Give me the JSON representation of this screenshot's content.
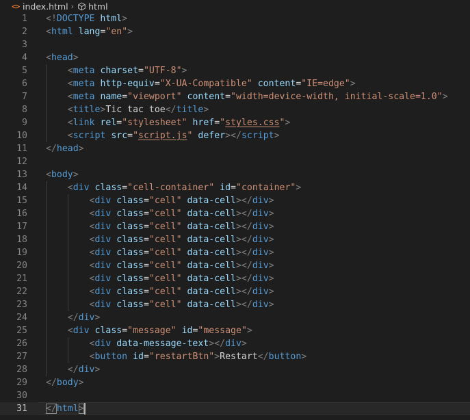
{
  "breadcrumb": {
    "file_icon": "<>",
    "file_name": "index.html",
    "separator": "›",
    "node_icon": "html-element-icon",
    "node_name": "html"
  },
  "theme": {
    "background": "#1e1e1e",
    "tag": "#569cd6",
    "bracket": "#808080",
    "attribute": "#9cdcfe",
    "string": "#ce9178",
    "text": "#d4d4d4",
    "line_number": "#858585"
  },
  "editor": {
    "current_line": 31,
    "lines": [
      {
        "n": "1",
        "indent": 0,
        "tokens": [
          [
            "br",
            "<!"
          ],
          [
            "tag",
            "DOCTYPE"
          ],
          [
            "txt",
            " "
          ],
          [
            "attr",
            "html"
          ],
          [
            "br",
            ">"
          ]
        ]
      },
      {
        "n": "2",
        "indent": 0,
        "tokens": [
          [
            "br",
            "<"
          ],
          [
            "tag",
            "html"
          ],
          [
            "txt",
            " "
          ],
          [
            "attr",
            "lang"
          ],
          [
            "txt",
            "="
          ],
          [
            "str",
            "\"en\""
          ],
          [
            "br",
            ">"
          ]
        ]
      },
      {
        "n": "3",
        "indent": 0,
        "tokens": []
      },
      {
        "n": "4",
        "indent": 0,
        "tokens": [
          [
            "br",
            "<"
          ],
          [
            "tag",
            "head"
          ],
          [
            "br",
            ">"
          ]
        ]
      },
      {
        "n": "5",
        "indent": 1,
        "tokens": [
          [
            "txt",
            "    "
          ],
          [
            "br",
            "<"
          ],
          [
            "tag",
            "meta"
          ],
          [
            "txt",
            " "
          ],
          [
            "attr",
            "charset"
          ],
          [
            "txt",
            "="
          ],
          [
            "str",
            "\"UTF-8\""
          ],
          [
            "br",
            ">"
          ]
        ]
      },
      {
        "n": "6",
        "indent": 1,
        "tokens": [
          [
            "txt",
            "    "
          ],
          [
            "br",
            "<"
          ],
          [
            "tag",
            "meta"
          ],
          [
            "txt",
            " "
          ],
          [
            "attr",
            "http-equiv"
          ],
          [
            "txt",
            "="
          ],
          [
            "str",
            "\"X-UA-Compatible\""
          ],
          [
            "txt",
            " "
          ],
          [
            "attr",
            "content"
          ],
          [
            "txt",
            "="
          ],
          [
            "str",
            "\"IE=edge\""
          ],
          [
            "br",
            ">"
          ]
        ]
      },
      {
        "n": "7",
        "indent": 1,
        "tokens": [
          [
            "txt",
            "    "
          ],
          [
            "br",
            "<"
          ],
          [
            "tag",
            "meta"
          ],
          [
            "txt",
            " "
          ],
          [
            "attr",
            "name"
          ],
          [
            "txt",
            "="
          ],
          [
            "str",
            "\"viewport\""
          ],
          [
            "txt",
            " "
          ],
          [
            "attr",
            "content"
          ],
          [
            "txt",
            "="
          ],
          [
            "str",
            "\"width=device-width, initial-scale=1.0\""
          ],
          [
            "br",
            ">"
          ]
        ]
      },
      {
        "n": "8",
        "indent": 1,
        "tokens": [
          [
            "txt",
            "    "
          ],
          [
            "br",
            "<"
          ],
          [
            "tag",
            "title"
          ],
          [
            "br",
            ">"
          ],
          [
            "txt",
            "Tic tac toe"
          ],
          [
            "br",
            "</"
          ],
          [
            "tag",
            "title"
          ],
          [
            "br",
            ">"
          ]
        ]
      },
      {
        "n": "9",
        "indent": 1,
        "tokens": [
          [
            "txt",
            "    "
          ],
          [
            "br",
            "<"
          ],
          [
            "tag",
            "link"
          ],
          [
            "txt",
            " "
          ],
          [
            "attr",
            "rel"
          ],
          [
            "txt",
            "="
          ],
          [
            "str",
            "\"stylesheet\""
          ],
          [
            "txt",
            " "
          ],
          [
            "attr",
            "href"
          ],
          [
            "txt",
            "="
          ],
          [
            "str",
            "\""
          ],
          [
            "strlink",
            "styles.css"
          ],
          [
            "str",
            "\""
          ],
          [
            "br",
            ">"
          ]
        ]
      },
      {
        "n": "10",
        "indent": 1,
        "tokens": [
          [
            "txt",
            "    "
          ],
          [
            "br",
            "<"
          ],
          [
            "tag",
            "script"
          ],
          [
            "txt",
            " "
          ],
          [
            "attr",
            "src"
          ],
          [
            "txt",
            "="
          ],
          [
            "str",
            "\""
          ],
          [
            "strlink",
            "script.js"
          ],
          [
            "str",
            "\""
          ],
          [
            "txt",
            " "
          ],
          [
            "attr",
            "defer"
          ],
          [
            "br",
            "></"
          ],
          [
            "tag",
            "script"
          ],
          [
            "br",
            ">"
          ]
        ]
      },
      {
        "n": "11",
        "indent": 0,
        "tokens": [
          [
            "br",
            "</"
          ],
          [
            "tag",
            "head"
          ],
          [
            "br",
            ">"
          ]
        ]
      },
      {
        "n": "12",
        "indent": 0,
        "tokens": []
      },
      {
        "n": "13",
        "indent": 0,
        "tokens": [
          [
            "br",
            "<"
          ],
          [
            "tag",
            "body"
          ],
          [
            "br",
            ">"
          ]
        ]
      },
      {
        "n": "14",
        "indent": 1,
        "tokens": [
          [
            "txt",
            "    "
          ],
          [
            "br",
            "<"
          ],
          [
            "tag",
            "div"
          ],
          [
            "txt",
            " "
          ],
          [
            "attr",
            "class"
          ],
          [
            "txt",
            "="
          ],
          [
            "str",
            "\"cell-container\""
          ],
          [
            "txt",
            " "
          ],
          [
            "attr",
            "id"
          ],
          [
            "txt",
            "="
          ],
          [
            "str",
            "\"container\""
          ],
          [
            "br",
            ">"
          ]
        ]
      },
      {
        "n": "15",
        "indent": 2,
        "tokens": [
          [
            "txt",
            "        "
          ],
          [
            "br",
            "<"
          ],
          [
            "tag",
            "div"
          ],
          [
            "txt",
            " "
          ],
          [
            "attr",
            "class"
          ],
          [
            "txt",
            "="
          ],
          [
            "str",
            "\"cell\""
          ],
          [
            "txt",
            " "
          ],
          [
            "attr",
            "data-cell"
          ],
          [
            "br",
            "></"
          ],
          [
            "tag",
            "div"
          ],
          [
            "br",
            ">"
          ]
        ]
      },
      {
        "n": "16",
        "indent": 2,
        "tokens": [
          [
            "txt",
            "        "
          ],
          [
            "br",
            "<"
          ],
          [
            "tag",
            "div"
          ],
          [
            "txt",
            " "
          ],
          [
            "attr",
            "class"
          ],
          [
            "txt",
            "="
          ],
          [
            "str",
            "\"cell\""
          ],
          [
            "txt",
            " "
          ],
          [
            "attr",
            "data-cell"
          ],
          [
            "br",
            "></"
          ],
          [
            "tag",
            "div"
          ],
          [
            "br",
            ">"
          ]
        ]
      },
      {
        "n": "17",
        "indent": 2,
        "tokens": [
          [
            "txt",
            "        "
          ],
          [
            "br",
            "<"
          ],
          [
            "tag",
            "div"
          ],
          [
            "txt",
            " "
          ],
          [
            "attr",
            "class"
          ],
          [
            "txt",
            "="
          ],
          [
            "str",
            "\"cell\""
          ],
          [
            "txt",
            " "
          ],
          [
            "attr",
            "data-cell"
          ],
          [
            "br",
            "></"
          ],
          [
            "tag",
            "div"
          ],
          [
            "br",
            ">"
          ]
        ]
      },
      {
        "n": "18",
        "indent": 2,
        "tokens": [
          [
            "txt",
            "        "
          ],
          [
            "br",
            "<"
          ],
          [
            "tag",
            "div"
          ],
          [
            "txt",
            " "
          ],
          [
            "attr",
            "class"
          ],
          [
            "txt",
            "="
          ],
          [
            "str",
            "\"cell\""
          ],
          [
            "txt",
            " "
          ],
          [
            "attr",
            "data-cell"
          ],
          [
            "br",
            "></"
          ],
          [
            "tag",
            "div"
          ],
          [
            "br",
            ">"
          ]
        ]
      },
      {
        "n": "19",
        "indent": 2,
        "tokens": [
          [
            "txt",
            "        "
          ],
          [
            "br",
            "<"
          ],
          [
            "tag",
            "div"
          ],
          [
            "txt",
            " "
          ],
          [
            "attr",
            "class"
          ],
          [
            "txt",
            "="
          ],
          [
            "str",
            "\"cell\""
          ],
          [
            "txt",
            " "
          ],
          [
            "attr",
            "data-cell"
          ],
          [
            "br",
            "></"
          ],
          [
            "tag",
            "div"
          ],
          [
            "br",
            ">"
          ]
        ]
      },
      {
        "n": "20",
        "indent": 2,
        "tokens": [
          [
            "txt",
            "        "
          ],
          [
            "br",
            "<"
          ],
          [
            "tag",
            "div"
          ],
          [
            "txt",
            " "
          ],
          [
            "attr",
            "class"
          ],
          [
            "txt",
            "="
          ],
          [
            "str",
            "\"cell\""
          ],
          [
            "txt",
            " "
          ],
          [
            "attr",
            "data-cell"
          ],
          [
            "br",
            "></"
          ],
          [
            "tag",
            "div"
          ],
          [
            "br",
            ">"
          ]
        ]
      },
      {
        "n": "21",
        "indent": 2,
        "tokens": [
          [
            "txt",
            "        "
          ],
          [
            "br",
            "<"
          ],
          [
            "tag",
            "div"
          ],
          [
            "txt",
            " "
          ],
          [
            "attr",
            "class"
          ],
          [
            "txt",
            "="
          ],
          [
            "str",
            "\"cell\""
          ],
          [
            "txt",
            " "
          ],
          [
            "attr",
            "data-cell"
          ],
          [
            "br",
            "></"
          ],
          [
            "tag",
            "div"
          ],
          [
            "br",
            ">"
          ]
        ]
      },
      {
        "n": "22",
        "indent": 2,
        "tokens": [
          [
            "txt",
            "        "
          ],
          [
            "br",
            "<"
          ],
          [
            "tag",
            "div"
          ],
          [
            "txt",
            " "
          ],
          [
            "attr",
            "class"
          ],
          [
            "txt",
            "="
          ],
          [
            "str",
            "\"cell\""
          ],
          [
            "txt",
            " "
          ],
          [
            "attr",
            "data-cell"
          ],
          [
            "br",
            "></"
          ],
          [
            "tag",
            "div"
          ],
          [
            "br",
            ">"
          ]
        ]
      },
      {
        "n": "23",
        "indent": 2,
        "tokens": [
          [
            "txt",
            "        "
          ],
          [
            "br",
            "<"
          ],
          [
            "tag",
            "div"
          ],
          [
            "txt",
            " "
          ],
          [
            "attr",
            "class"
          ],
          [
            "txt",
            "="
          ],
          [
            "str",
            "\"cell\""
          ],
          [
            "txt",
            " "
          ],
          [
            "attr",
            "data-cell"
          ],
          [
            "br",
            "></"
          ],
          [
            "tag",
            "div"
          ],
          [
            "br",
            ">"
          ]
        ]
      },
      {
        "n": "24",
        "indent": 1,
        "tokens": [
          [
            "txt",
            "    "
          ],
          [
            "br",
            "</"
          ],
          [
            "tag",
            "div"
          ],
          [
            "br",
            ">"
          ]
        ]
      },
      {
        "n": "25",
        "indent": 1,
        "tokens": [
          [
            "txt",
            "    "
          ],
          [
            "br",
            "<"
          ],
          [
            "tag",
            "div"
          ],
          [
            "txt",
            " "
          ],
          [
            "attr",
            "class"
          ],
          [
            "txt",
            "="
          ],
          [
            "str",
            "\"message\""
          ],
          [
            "txt",
            " "
          ],
          [
            "attr",
            "id"
          ],
          [
            "txt",
            "="
          ],
          [
            "str",
            "\"message\""
          ],
          [
            "br",
            ">"
          ]
        ]
      },
      {
        "n": "26",
        "indent": 2,
        "tokens": [
          [
            "txt",
            "        "
          ],
          [
            "br",
            "<"
          ],
          [
            "tag",
            "div"
          ],
          [
            "txt",
            " "
          ],
          [
            "attr",
            "data-message-text"
          ],
          [
            "br",
            "></"
          ],
          [
            "tag",
            "div"
          ],
          [
            "br",
            ">"
          ]
        ]
      },
      {
        "n": "27",
        "indent": 2,
        "tokens": [
          [
            "txt",
            "        "
          ],
          [
            "br",
            "<"
          ],
          [
            "tag",
            "button"
          ],
          [
            "txt",
            " "
          ],
          [
            "attr",
            "id"
          ],
          [
            "txt",
            "="
          ],
          [
            "str",
            "\"restartBtn\""
          ],
          [
            "br",
            ">"
          ],
          [
            "txt",
            "Restart"
          ],
          [
            "br",
            "</"
          ],
          [
            "tag",
            "button"
          ],
          [
            "br",
            ">"
          ]
        ]
      },
      {
        "n": "28",
        "indent": 1,
        "tokens": [
          [
            "txt",
            "    "
          ],
          [
            "br",
            "</"
          ],
          [
            "tag",
            "div"
          ],
          [
            "br",
            ">"
          ]
        ]
      },
      {
        "n": "29",
        "indent": 0,
        "tokens": [
          [
            "br",
            "</"
          ],
          [
            "tag",
            "body"
          ],
          [
            "br",
            ">"
          ]
        ]
      },
      {
        "n": "30",
        "indent": 0,
        "tokens": []
      },
      {
        "n": "31",
        "indent": 0,
        "tokens": [
          [
            "brmatch",
            "</"
          ],
          [
            "tag",
            "html"
          ],
          [
            "brmatch",
            ">"
          ],
          [
            "caret",
            ""
          ]
        ]
      }
    ]
  }
}
